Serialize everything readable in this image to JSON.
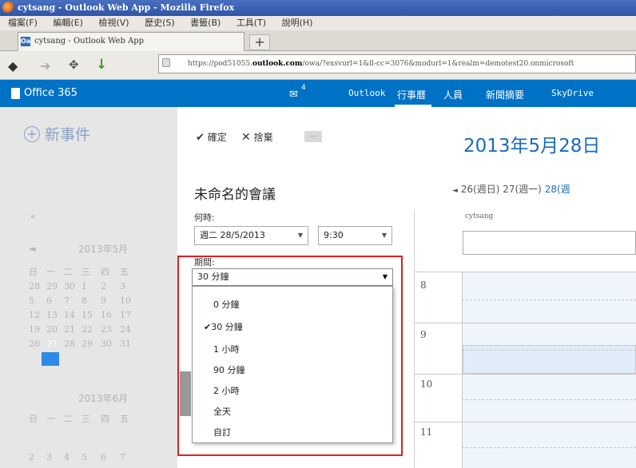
{
  "browser": {
    "window_title": "cytsang - Outlook Web App - Mozilla Firefox",
    "menu": [
      "檔案(F)",
      "編輯(E)",
      "檢視(V)",
      "歷史(S)",
      "書籤(B)",
      "工具(T)",
      "說明(H)"
    ],
    "tab_title": "cytsang - Outlook Web App",
    "tab_icon": "Oa",
    "new_tab": "+",
    "url_prefix": "https://pod51055.",
    "url_domain": "outlook.com",
    "url_rest": "/owa/?exsvurl=1&ll-cc=3076&modurl=1&realm=demotest20.onmicrosoft"
  },
  "o365": {
    "brand": "Office 365",
    "mail_count": "4",
    "nav": [
      "Outlook",
      "行事曆",
      "人員",
      "新聞摘要",
      "SkyDrive"
    ],
    "active_nav": "行事曆"
  },
  "left": {
    "new_event": "新事件",
    "collapse": "«",
    "month1": "2013年5月",
    "month2": "2013年6月",
    "weekdays": [
      "日",
      "一",
      "二",
      "三",
      "四",
      "五"
    ],
    "may_rows": [
      [
        "28",
        "29",
        "30",
        "1",
        "2",
        "3"
      ],
      [
        "5",
        "6",
        "7",
        "8",
        "9",
        "10"
      ],
      [
        "12",
        "13",
        "14",
        "15",
        "16",
        "17"
      ],
      [
        "19",
        "20",
        "21",
        "22",
        "23",
        "24"
      ],
      [
        "26",
        "27",
        "28",
        "29",
        "30",
        "31"
      ]
    ],
    "june_row": [
      "2",
      "3",
      "4",
      "5",
      "6",
      "7"
    ]
  },
  "editor": {
    "ok": "確定",
    "discard": "捨棄",
    "more": "...",
    "title": "未命名的會議",
    "when_label": "何時:",
    "date_value": "週二 28/5/2013",
    "time_value": "9:30",
    "duration_label": "期間:",
    "duration_value": "30 分鐘",
    "duration_options": [
      "0 分鐘",
      "30 分鐘",
      "1 小時",
      "90 分鐘",
      "2 小時",
      "全天",
      "自訂"
    ],
    "selected_option": "30 分鐘"
  },
  "calendar": {
    "date_title": "2013年5月28日",
    "day_prev_arrow": "◄",
    "day_nav_1": "26(週日)",
    "day_nav_2": "27(週一)",
    "day_nav_current": "28(週",
    "owner": "cytsang",
    "hours": [
      "8",
      "9",
      "10",
      "11"
    ]
  },
  "colors": {
    "o365_blue": "#0072c6",
    "accent_blue": "#1a6bb8",
    "highlight_red": "#e02020"
  }
}
